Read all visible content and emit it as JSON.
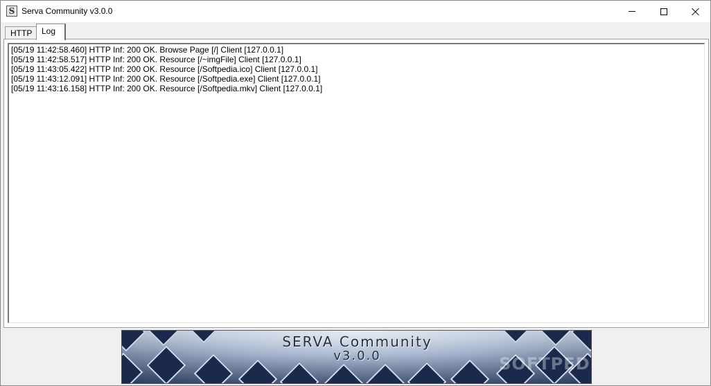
{
  "window": {
    "title": "Serva Community v3.0.0",
    "icon": "serva-app-icon",
    "icon_letter": "S",
    "controls": [
      "minimize-icon",
      "maximize-icon",
      "close-icon"
    ]
  },
  "tabs": [
    {
      "label": "HTTP",
      "active": false
    },
    {
      "label": "Log",
      "active": true
    }
  ],
  "log": {
    "lines": [
      "[05/19 11:42:58.460] HTTP Inf: 200 OK. Browse Page [/] Client [127.0.0.1]",
      "[05/19 11:42:58.517] HTTP Inf: 200 OK. Resource [/~imgFile] Client [127.0.0.1]",
      "[05/19 11:43:05.422] HTTP Inf: 200 OK. Resource [/Softpedia.ico] Client [127.0.0.1]",
      "[05/19 11:43:12.091] HTTP Inf: 200 OK. Resource [/Softpedia.exe] Client [127.0.0.1]",
      "[05/19 11:43:16.158] HTTP Inf: 200 OK. Resource [/Softpedia.mkv] Client [127.0.0.1]"
    ]
  },
  "banner": {
    "title": "SERVA Community",
    "version": "v3.0.0"
  },
  "watermark": "SOFTPEDIA",
  "colors": {
    "titlebar": "#ffffff",
    "chrome": "#f0f0f0",
    "log_background": "#ffffff",
    "banner_dark": "#1b2a4c",
    "banner_light": "#c8d4e6"
  }
}
